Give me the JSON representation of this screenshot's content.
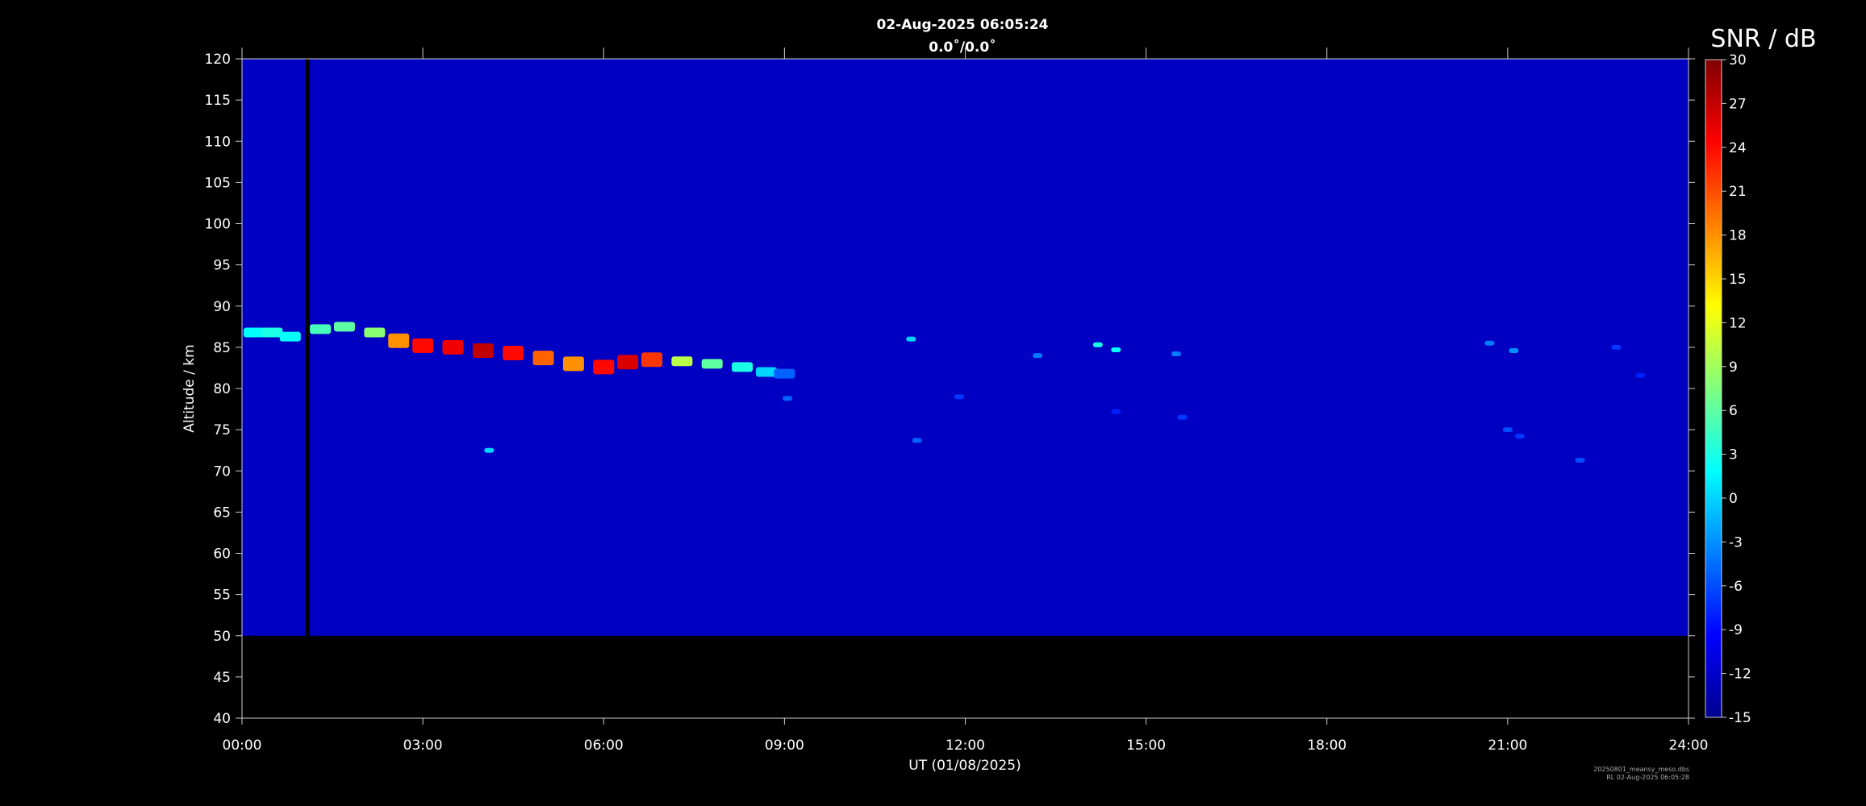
{
  "chart_data": {
    "type": "heatmap",
    "title": "02-Aug-2025 06:05:24",
    "subtitle": "0.0˚/0.0˚",
    "xlabel": "UT (01/08/2025)",
    "ylabel": "Altitude / km",
    "xlim": [
      0,
      24
    ],
    "ylim": [
      40,
      120
    ],
    "data_altitude_range": [
      50,
      120
    ],
    "x_ticks": [
      "00:00",
      "03:00",
      "06:00",
      "09:00",
      "12:00",
      "15:00",
      "18:00",
      "21:00",
      "24:00"
    ],
    "x_tick_values": [
      0,
      3,
      6,
      9,
      12,
      15,
      18,
      21,
      24
    ],
    "y_ticks": [
      40,
      45,
      50,
      55,
      60,
      65,
      70,
      75,
      80,
      85,
      90,
      95,
      100,
      105,
      110,
      115,
      120
    ],
    "background_snr_db": -12,
    "data_gap_ut": [
      1.05,
      1.12
    ],
    "colorbar": {
      "label": "SNR / dB",
      "range": [
        -15,
        30
      ],
      "ticks": [
        -15,
        -12,
        -9,
        -6,
        -3,
        0,
        3,
        6,
        9,
        12,
        15,
        18,
        21,
        24,
        27,
        30
      ],
      "colormap": "jet"
    },
    "echo_layers": [
      {
        "name": "main-layer",
        "points": [
          {
            "ut": 0.2,
            "alt": 86.8,
            "snr": 2
          },
          {
            "ut": 0.5,
            "alt": 86.8,
            "snr": 3
          },
          {
            "ut": 0.8,
            "alt": 86.3,
            "snr": 2
          },
          {
            "ut": 1.3,
            "alt": 87.2,
            "snr": 5
          },
          {
            "ut": 1.7,
            "alt": 87.5,
            "snr": 6
          },
          {
            "ut": 2.2,
            "alt": 86.8,
            "snr": 8
          },
          {
            "ut": 2.6,
            "alt": 85.8,
            "snr": 18
          },
          {
            "ut": 3.0,
            "alt": 85.2,
            "snr": 24
          },
          {
            "ut": 3.5,
            "alt": 85.0,
            "snr": 25
          },
          {
            "ut": 4.0,
            "alt": 84.6,
            "snr": 27
          },
          {
            "ut": 4.5,
            "alt": 84.3,
            "snr": 24
          },
          {
            "ut": 5.0,
            "alt": 83.7,
            "snr": 20
          },
          {
            "ut": 5.5,
            "alt": 83.0,
            "snr": 18
          },
          {
            "ut": 6.0,
            "alt": 82.6,
            "snr": 24
          },
          {
            "ut": 6.4,
            "alt": 83.2,
            "snr": 26
          },
          {
            "ut": 6.8,
            "alt": 83.5,
            "snr": 22
          },
          {
            "ut": 7.3,
            "alt": 83.3,
            "snr": 10
          },
          {
            "ut": 7.8,
            "alt": 83.0,
            "snr": 6
          },
          {
            "ut": 8.3,
            "alt": 82.6,
            "snr": 3
          },
          {
            "ut": 8.7,
            "alt": 82.0,
            "snr": 0
          },
          {
            "ut": 9.0,
            "alt": 81.8,
            "snr": -5
          }
        ]
      },
      {
        "name": "late-echoes",
        "points": [
          {
            "ut": 11.1,
            "alt": 86.0,
            "snr": 0
          },
          {
            "ut": 13.2,
            "alt": 84.0,
            "snr": -4
          },
          {
            "ut": 14.2,
            "alt": 85.3,
            "snr": 3
          },
          {
            "ut": 14.5,
            "alt": 84.7,
            "snr": 2
          },
          {
            "ut": 15.5,
            "alt": 84.2,
            "snr": -4
          },
          {
            "ut": 20.7,
            "alt": 85.5,
            "snr": -4
          },
          {
            "ut": 21.1,
            "alt": 84.6,
            "snr": -3
          },
          {
            "ut": 21.0,
            "alt": 75.0,
            "snr": -6
          },
          {
            "ut": 21.2,
            "alt": 74.2,
            "snr": -7
          },
          {
            "ut": 22.2,
            "alt": 71.3,
            "snr": -6
          },
          {
            "ut": 22.8,
            "alt": 85.0,
            "snr": -7
          },
          {
            "ut": 23.2,
            "alt": 81.6,
            "snr": -8
          }
        ]
      },
      {
        "name": "isolated-points",
        "points": [
          {
            "ut": 4.1,
            "alt": 72.5,
            "snr": 0
          },
          {
            "ut": 9.05,
            "alt": 78.8,
            "snr": -5
          },
          {
            "ut": 11.2,
            "alt": 73.7,
            "snr": -5
          },
          {
            "ut": 11.9,
            "alt": 79.0,
            "snr": -7
          },
          {
            "ut": 14.5,
            "alt": 77.2,
            "snr": -8
          },
          {
            "ut": 15.6,
            "alt": 76.5,
            "snr": -7
          }
        ]
      }
    ],
    "footnote_lines": [
      "20250801_meansy_meso.dbs",
      "RL 02-Aug-2025 06:05:28"
    ]
  }
}
